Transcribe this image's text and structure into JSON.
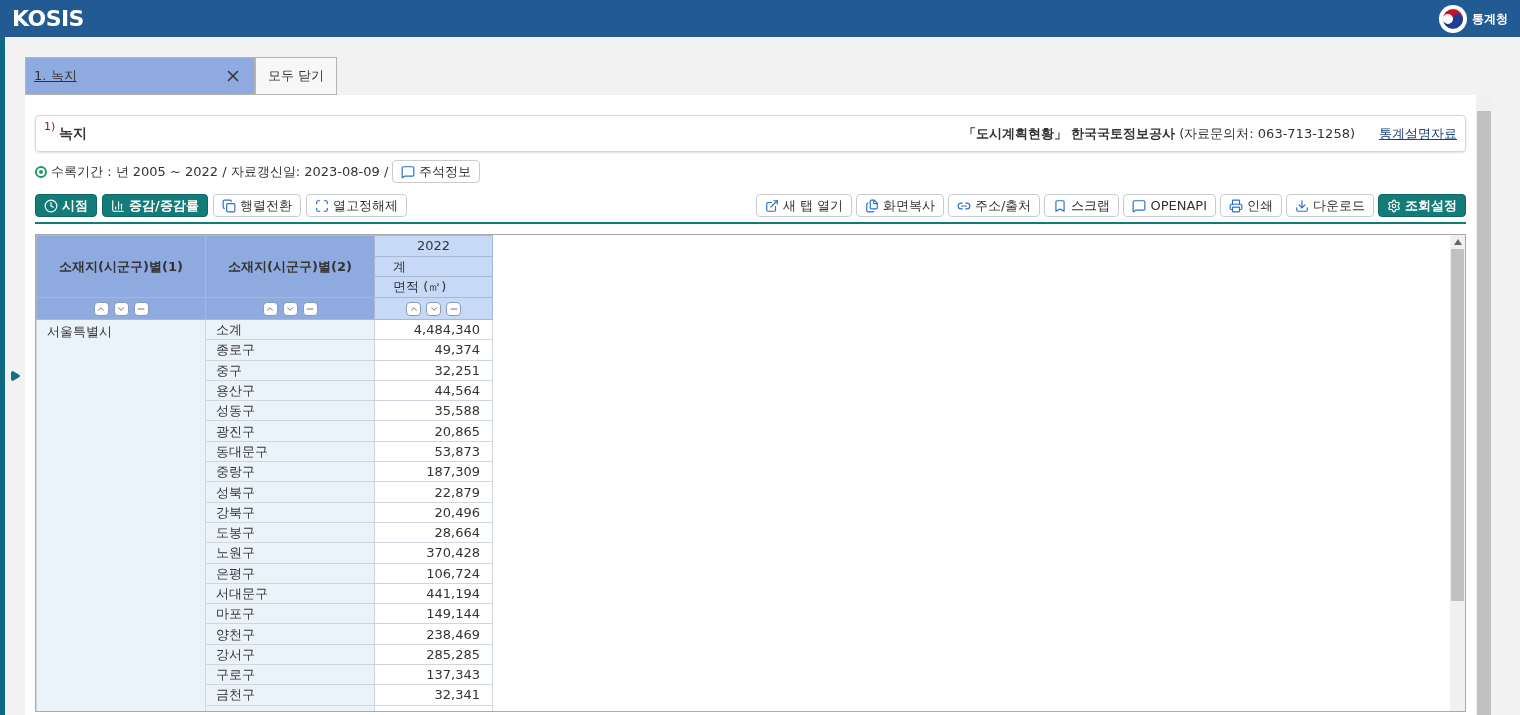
{
  "header": {
    "logo": "KOSIS",
    "agency": "통계청"
  },
  "tabs": [
    {
      "label": "1. 녹지",
      "selected": true,
      "closable": true
    },
    {
      "label": "모두 닫기",
      "selected": false,
      "closable": false
    }
  ],
  "title": {
    "note": "1)",
    "text": "녹지",
    "source": "「도시계획현황」 한국국토정보공사",
    "contact": "(자료문의처: 063-713-1258)",
    "link": "통계설명자료"
  },
  "info": {
    "text": "수록기간 : 년 2005 ~ 2022 / 자료갱신일: 2023-08-09 /",
    "button": "주석정보"
  },
  "toolbar_left": [
    {
      "label": "시점",
      "kind": "primary"
    },
    {
      "label": "증감/증감률",
      "kind": "primary"
    },
    {
      "label": "행렬전환",
      "kind": "normal"
    },
    {
      "label": "열고정해제",
      "kind": "normal"
    }
  ],
  "toolbar_right": [
    {
      "label": "새 탭 열기",
      "kind": "normal"
    },
    {
      "label": "화면복사",
      "kind": "normal"
    },
    {
      "label": "주소/출처",
      "kind": "normal"
    },
    {
      "label": "스크랩",
      "kind": "normal"
    },
    {
      "label": "OPENAPI",
      "kind": "normal"
    },
    {
      "label": "인쇄",
      "kind": "normal"
    },
    {
      "label": "다운로드",
      "kind": "normal"
    },
    {
      "label": "조회설정",
      "kind": "primary"
    }
  ],
  "table": {
    "columns": [
      "소재지(시군구)별(1)",
      "소재지(시군구)별(2)"
    ],
    "year": "2022",
    "item": "계",
    "unit": "면적 (㎡)",
    "group": "서울특별시",
    "rows": [
      {
        "name": "소계",
        "value": "4,484,340"
      },
      {
        "name": "종로구",
        "value": "49,374"
      },
      {
        "name": "중구",
        "value": "32,251"
      },
      {
        "name": "용산구",
        "value": "44,564"
      },
      {
        "name": "성동구",
        "value": "35,588"
      },
      {
        "name": "광진구",
        "value": "20,865"
      },
      {
        "name": "동대문구",
        "value": "53,873"
      },
      {
        "name": "중랑구",
        "value": "187,309"
      },
      {
        "name": "성북구",
        "value": "22,879"
      },
      {
        "name": "강북구",
        "value": "20,496"
      },
      {
        "name": "도봉구",
        "value": "28,664"
      },
      {
        "name": "노원구",
        "value": "370,428"
      },
      {
        "name": "은평구",
        "value": "106,724"
      },
      {
        "name": "서대문구",
        "value": "441,194"
      },
      {
        "name": "마포구",
        "value": "149,144"
      },
      {
        "name": "양천구",
        "value": "238,469"
      },
      {
        "name": "강서구",
        "value": "285,285"
      },
      {
        "name": "구로구",
        "value": "137,343"
      },
      {
        "name": "금천구",
        "value": "32,341"
      }
    ]
  }
}
